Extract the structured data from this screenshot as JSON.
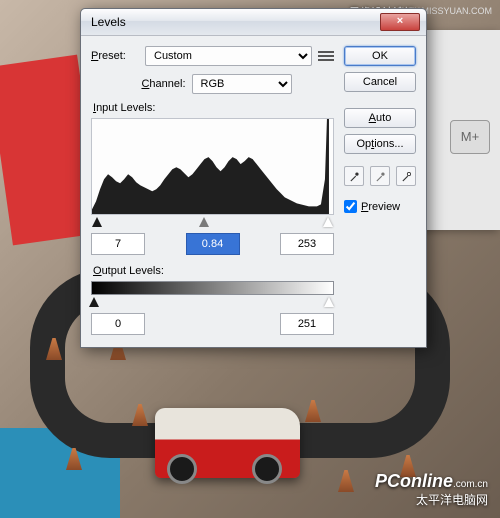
{
  "watermarks": {
    "forum": "思缘设计论坛",
    "miss": "WWW.MISSYUAN.COM",
    "pconline": "PConline",
    "pconline_sub": "太平洋电脑网",
    "pconline_domain": ".com.cn"
  },
  "dialog": {
    "title": "Levels",
    "preset_label": "Preset:",
    "preset_value": "Custom",
    "channel_label": "Channel:",
    "channel_value": "RGB",
    "input_levels_label": "Input Levels:",
    "output_levels_label": "Output Levels:",
    "input": {
      "black": "7",
      "gamma": "0.84",
      "white": "253"
    },
    "output": {
      "black": "0",
      "white": "251"
    },
    "buttons": {
      "ok": "OK",
      "cancel": "Cancel",
      "auto": "Auto",
      "options": "Options..."
    },
    "preview_label": "Preview",
    "preview_checked": true
  }
}
